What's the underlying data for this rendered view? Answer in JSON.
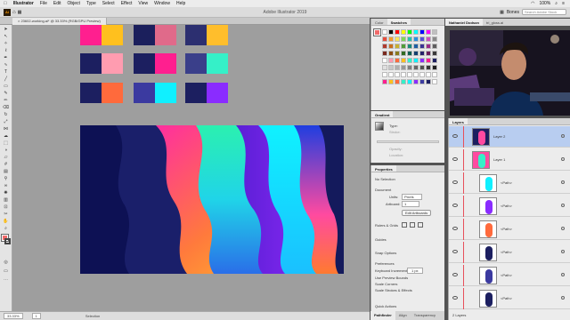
{
  "menubar": {
    "apple": "",
    "app_name": "Illustrator",
    "items": [
      "File",
      "Edit",
      "Object",
      "Type",
      "Select",
      "Effect",
      "View",
      "Window",
      "Help"
    ],
    "status_right": "100%"
  },
  "appbar": {
    "window_title": "Adobe Illustrator 2019",
    "workspace": "Bones",
    "search_placeholder": "Search Adobe Stock"
  },
  "document_tab": {
    "label": "× 23602-working.ai* @ 33.33% (RGB/GPU Preview)"
  },
  "statusbar": {
    "zoom": "33.33%",
    "page": "1",
    "tool_name": "Selection"
  },
  "swatches_panel": {
    "tabs": [
      "Color",
      "Swatches"
    ],
    "active_tab": "Swatches"
  },
  "gradient_panel": {
    "title": "Gradient",
    "type_label": "Type:",
    "stroke_label": "Stroke:",
    "angle_label": "",
    "opacity_label": "Opacity:",
    "location_label": "Location:"
  },
  "properties_panel": {
    "title": "Properties",
    "no_selection": "No Selection",
    "document_label": "Document",
    "units_label": "Units:",
    "units_value": "Pixels",
    "artboard_label": "Artboard:",
    "artboard_value": "1",
    "edit_artboards_button": "Edit Artboards",
    "rulers_label": "Rulers & Grids",
    "guides_label": "Guides",
    "snap_label": "Snap Options",
    "preferences_label": "Preferences",
    "keyboard_increment_label": "Keyboard Increment:",
    "keyboard_increment_value": "1 px",
    "use_preview_bounds": "Use Preview Bounds",
    "scale_corners": "Scale Corners",
    "scale_strokes": "Scale Strokes & Effects",
    "quick_actions": "Quick Actions"
  },
  "bottom_tabs": [
    "Pathfinder",
    "Align",
    "Transparency"
  ],
  "webcam_tabs": [
    "Nathaniel Dodson",
    "tri_gloss.ai"
  ],
  "layers_panel": {
    "title": "Layers",
    "layers": [
      {
        "name": "Layer 2",
        "selected": true
      },
      {
        "name": "Layer 1",
        "selected": false
      }
    ],
    "paths": [
      "<Path>",
      "<Path>",
      "<Path>",
      "<Path>",
      "<Path>",
      "<Path>"
    ],
    "footer": "2 Layers"
  },
  "colors": {
    "accent_blue": "#1473e6",
    "selected_layer": "#b8cdf0",
    "artboard_bg": "#141a5c"
  },
  "canvas_swatches": [
    [
      "#ff1f8f",
      "#ffc01e",
      "#1b1f5c",
      "#e06a8a",
      "#2c2f70",
      "#ffbe2c"
    ],
    [
      "#1c1f60",
      "#ff9cb0",
      "#1c1f60",
      "#ff1f8f",
      "#3a3f8a",
      "#35f0c8"
    ],
    [
      "#1c1f60",
      "#ff6a3c",
      "#3b3aa0",
      "#10f0ff",
      "#1c1f60",
      "#8a2cff"
    ]
  ]
}
